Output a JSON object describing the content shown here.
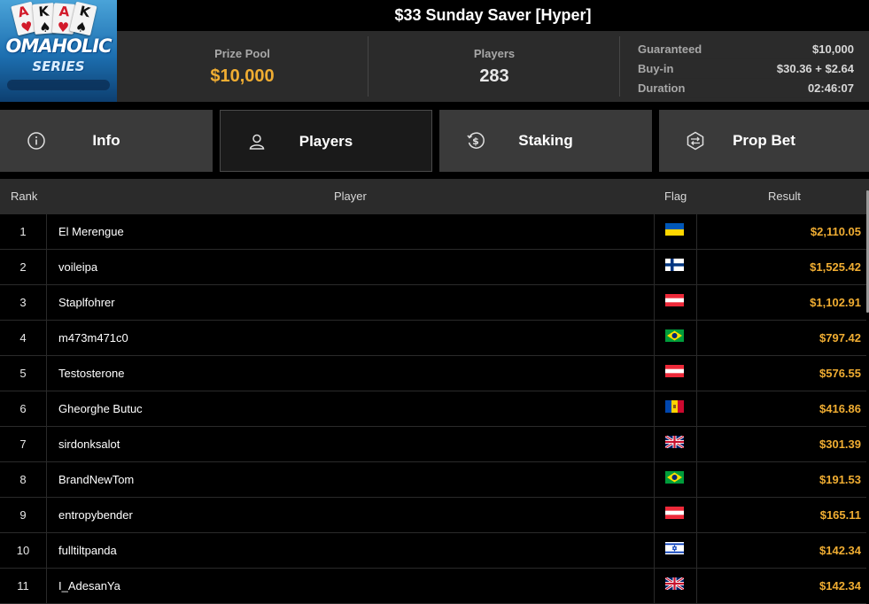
{
  "logo": {
    "cards": [
      "A",
      "K",
      "A",
      "K"
    ],
    "line1": "OMAHOLIC",
    "line2": "SERIES"
  },
  "title": "$33 Sunday Saver [Hyper]",
  "stats": {
    "prize_pool_label": "Prize Pool",
    "prize_pool_value": "$10,000",
    "players_label": "Players",
    "players_value": "283",
    "guaranteed_label": "Guaranteed",
    "guaranteed_value": "$10,000",
    "buyin_label": "Buy-in",
    "buyin_value": "$30.36 + $2.64",
    "duration_label": "Duration",
    "duration_value": "02:46:07"
  },
  "tabs": [
    {
      "label": "Info",
      "icon": "info-icon",
      "active": false
    },
    {
      "label": "Players",
      "icon": "user-icon",
      "active": true
    },
    {
      "label": "Staking",
      "icon": "dollar-refresh-icon",
      "active": false
    },
    {
      "label": "Prop Bet",
      "icon": "prop-bet-icon",
      "active": false
    }
  ],
  "table": {
    "headers": {
      "rank": "Rank",
      "player": "Player",
      "flag": "Flag",
      "result": "Result"
    },
    "rows": [
      {
        "rank": "1",
        "player": "El Merengue",
        "flag": "ukraine",
        "result": "$2,110.05"
      },
      {
        "rank": "2",
        "player": "voileipa",
        "flag": "finland",
        "result": "$1,525.42"
      },
      {
        "rank": "3",
        "player": "Staplfohrer",
        "flag": "austria",
        "result": "$1,102.91"
      },
      {
        "rank": "4",
        "player": "m473m471c0",
        "flag": "brazil",
        "result": "$797.42"
      },
      {
        "rank": "5",
        "player": "Testosterone",
        "flag": "austria",
        "result": "$576.55"
      },
      {
        "rank": "6",
        "player": "Gheorghe Butuc",
        "flag": "moldova",
        "result": "$416.86"
      },
      {
        "rank": "7",
        "player": "sirdonksalot",
        "flag": "united-kingdom",
        "result": "$301.39"
      },
      {
        "rank": "8",
        "player": "BrandNewTom",
        "flag": "brazil",
        "result": "$191.53"
      },
      {
        "rank": "9",
        "player": "entropybender",
        "flag": "austria",
        "result": "$165.11"
      },
      {
        "rank": "10",
        "player": "fulltiltpanda",
        "flag": "israel",
        "result": "$142.34"
      },
      {
        "rank": "11",
        "player": "I_AdesanYa",
        "flag": "united-kingdom",
        "result": "$142.34"
      }
    ]
  },
  "colors": {
    "accent": "#f0ad32",
    "panel": "#2b2b2b",
    "tab": "#3a3a3a"
  }
}
